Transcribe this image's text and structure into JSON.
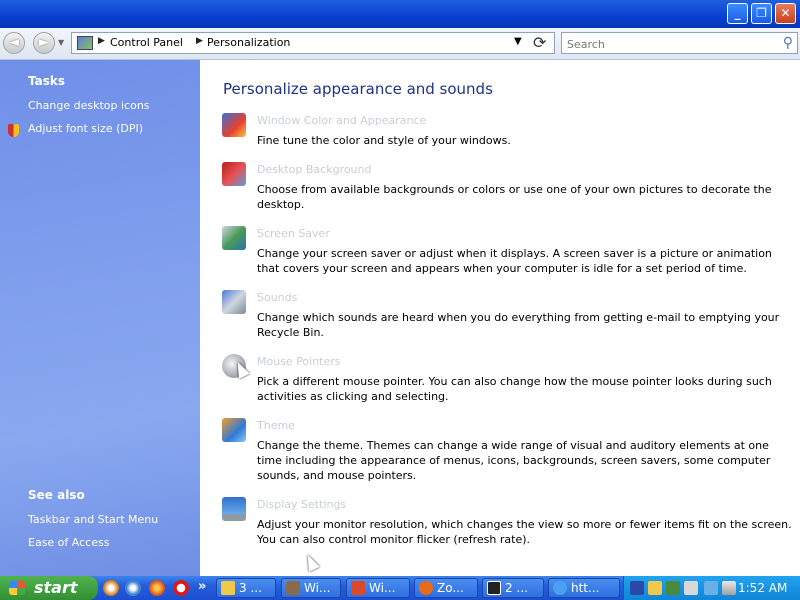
{
  "window": {
    "minimize_glyph": "_",
    "maximize_glyph": "❐",
    "close_glyph": "✕"
  },
  "navbar": {
    "back_glyph": "◄",
    "forward_glyph": "►",
    "breadcrumbs": [
      "Control Panel",
      "Personalization"
    ],
    "search_placeholder": "Search"
  },
  "sidebar": {
    "tasks_heading": "Tasks",
    "tasks": [
      "Change desktop icons",
      "Adjust font size (DPI)"
    ],
    "see_also_heading": "See also",
    "see_also": [
      "Taskbar and Start Menu",
      "Ease of Access"
    ]
  },
  "main": {
    "title": "Personalize appearance and sounds",
    "items": [
      {
        "title": "Window Color and Appearance",
        "desc": "Fine tune the color and style of your windows.",
        "icon": "window-color-icon"
      },
      {
        "title": "Desktop Background",
        "desc": "Choose from available backgrounds or colors or use one of your own pictures to decorate the desktop.",
        "icon": "desktop-background-icon"
      },
      {
        "title": "Screen Saver",
        "desc": "Change your screen saver or adjust when it displays. A screen saver is a picture or animation that covers your screen and appears when your computer is idle for a set period of time.",
        "icon": "screen-saver-icon"
      },
      {
        "title": "Sounds",
        "desc": "Change which sounds are heard when you do everything from getting e-mail to emptying your Recycle Bin.",
        "icon": "sounds-icon"
      },
      {
        "title": "Mouse Pointers",
        "desc": "Pick a different mouse pointer. You can also change how the mouse pointer looks during such activities as clicking and selecting.",
        "icon": "mouse-icon"
      },
      {
        "title": "Theme",
        "desc": "Change the theme. Themes can change a wide range of visual and auditory elements at one time including the appearance of menus, icons, backgrounds, screen savers, some computer sounds, and mouse pointers.",
        "icon": "theme-icon"
      },
      {
        "title": "Display Settings",
        "desc": "Adjust your monitor resolution, which changes the view so more or fewer items fit on the screen. You can also control monitor flicker (refresh rate).",
        "icon": "monitor-icon"
      }
    ]
  },
  "taskbar": {
    "start_label": "start",
    "quicklaunch_more": "»",
    "tasks": [
      "3 ...",
      "Wi...",
      "Wi...",
      "Zo...",
      "2 ...",
      "htt..."
    ],
    "clock": "1:52 AM"
  },
  "colors": {
    "title_blue": "#1e3287",
    "link_disabled": "#c8cdd6",
    "sidebar_blue": "#7d9cec"
  }
}
